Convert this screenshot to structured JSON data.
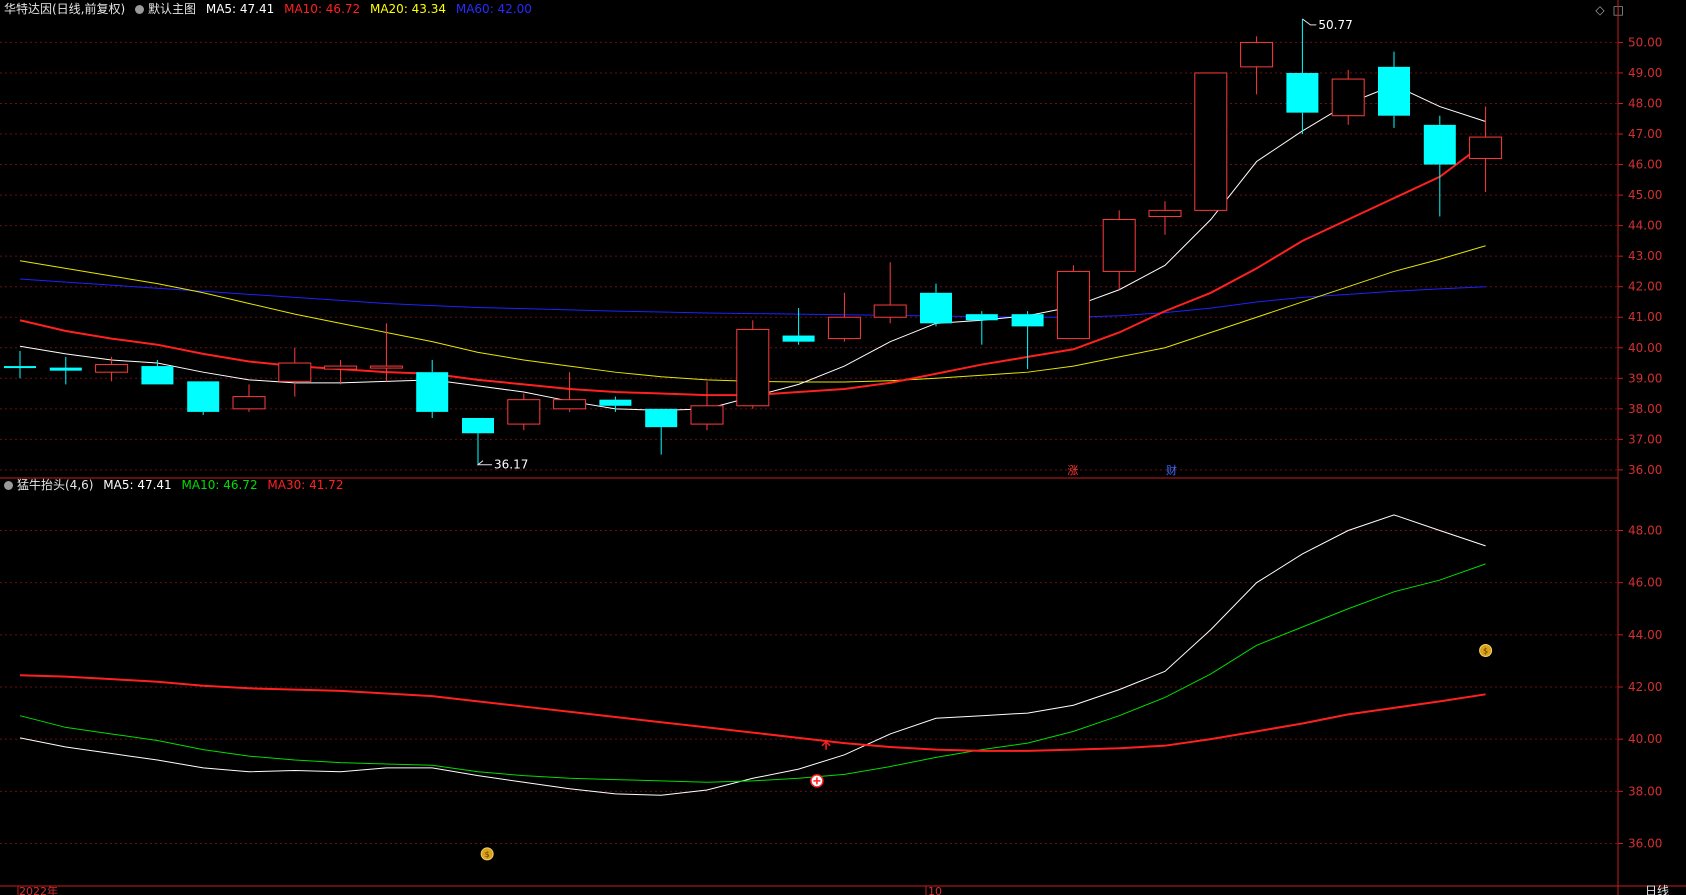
{
  "header": {
    "stock_title": "华特达因(日线,前复权)",
    "main_chart_label": "默认主图",
    "ma5": "MA5: 47.41",
    "ma10": "MA10: 46.72",
    "ma20": "MA20: 43.34",
    "ma60": "MA60: 42.00",
    "colors": {
      "ma5": "#ffffff",
      "ma10": "#ff2020",
      "ma20": "#ffff00",
      "ma60": "#2020ff",
      "up": "#ff3b3b",
      "down": "#00ffff"
    }
  },
  "indicator_header": {
    "name": "猛牛抬头(4,6)",
    "ma5": "MA5: 47.41",
    "ma10": "MA10: 46.72",
    "ma30": "MA30: 41.72",
    "colors": {
      "ma5": "#ffffff",
      "ma10": "#00dd00",
      "ma30": "#ff2020"
    }
  },
  "annotations": {
    "high_label": "50.77",
    "low_label": "36.17",
    "zhang_badge": "涨",
    "cai_badge": "财"
  },
  "bottom_axis": {
    "year_label": "2022年",
    "month_label": "10",
    "period_label": "日线"
  },
  "chart_data": [
    {
      "type": "candlestick",
      "ylim": [
        35.8,
        50.8
      ],
      "y_ticks": [
        "50.00",
        "49.00",
        "48.00",
        "47.00",
        "46.00",
        "45.00",
        "44.00",
        "43.00",
        "42.00",
        "41.00",
        "40.00",
        "39.00",
        "38.00",
        "37.00",
        "36.00"
      ],
      "grid": "horizontal dotted",
      "candles": [
        {
          "o": 39.4,
          "h": 39.9,
          "l": 39.0,
          "c": 39.35
        },
        {
          "o": 39.35,
          "h": 39.7,
          "l": 38.8,
          "c": 39.25
        },
        {
          "o": 39.2,
          "h": 39.7,
          "l": 38.9,
          "c": 39.45
        },
        {
          "o": 39.4,
          "h": 39.6,
          "l": 38.8,
          "c": 38.8
        },
        {
          "o": 38.9,
          "h": 38.9,
          "l": 37.8,
          "c": 37.9
        },
        {
          "o": 38.0,
          "h": 38.8,
          "l": 37.9,
          "c": 38.4
        },
        {
          "o": 38.9,
          "h": 40.0,
          "l": 38.4,
          "c": 39.5
        },
        {
          "o": 39.3,
          "h": 39.6,
          "l": 38.8,
          "c": 39.4
        },
        {
          "o": 39.35,
          "h": 40.8,
          "l": 38.9,
          "c": 39.4
        },
        {
          "o": 39.2,
          "h": 39.6,
          "l": 37.7,
          "c": 37.9
        },
        {
          "o": 37.7,
          "h": 37.7,
          "l": 36.17,
          "c": 37.2
        },
        {
          "o": 37.5,
          "h": 38.5,
          "l": 37.3,
          "c": 38.3
        },
        {
          "o": 38.0,
          "h": 39.2,
          "l": 37.9,
          "c": 38.3
        },
        {
          "o": 38.3,
          "h": 38.4,
          "l": 37.9,
          "c": 38.1
        },
        {
          "o": 38.0,
          "h": 38.0,
          "l": 36.5,
          "c": 37.4
        },
        {
          "o": 37.5,
          "h": 38.9,
          "l": 37.3,
          "c": 38.1
        },
        {
          "o": 38.1,
          "h": 40.9,
          "l": 38.0,
          "c": 40.6
        },
        {
          "o": 40.4,
          "h": 41.3,
          "l": 40.1,
          "c": 40.2
        },
        {
          "o": 40.3,
          "h": 41.8,
          "l": 40.2,
          "c": 41.0
        },
        {
          "o": 41.0,
          "h": 42.8,
          "l": 40.8,
          "c": 41.4
        },
        {
          "o": 41.8,
          "h": 42.1,
          "l": 40.7,
          "c": 40.8
        },
        {
          "o": 41.1,
          "h": 41.2,
          "l": 40.1,
          "c": 40.9
        },
        {
          "o": 41.1,
          "h": 41.2,
          "l": 39.3,
          "c": 40.7
        },
        {
          "o": 40.3,
          "h": 42.7,
          "l": 40.3,
          "c": 42.5
        },
        {
          "o": 42.5,
          "h": 44.5,
          "l": 41.9,
          "c": 44.2
        },
        {
          "o": 44.3,
          "h": 44.8,
          "l": 43.7,
          "c": 44.5
        },
        {
          "o": 44.5,
          "h": 49.0,
          "l": 44.5,
          "c": 49.0
        },
        {
          "o": 49.2,
          "h": 50.2,
          "l": 48.3,
          "c": 50.0
        },
        {
          "o": 49.0,
          "h": 50.77,
          "l": 47.0,
          "c": 47.7
        },
        {
          "o": 47.6,
          "h": 49.1,
          "l": 47.3,
          "c": 48.8
        },
        {
          "o": 49.2,
          "h": 49.7,
          "l": 47.2,
          "c": 47.6
        },
        {
          "o": 47.3,
          "h": 47.6,
          "l": 44.3,
          "c": 46.0
        },
        {
          "o": 46.2,
          "h": 47.9,
          "l": 45.1,
          "c": 46.9
        }
      ],
      "series": [
        {
          "name": "MA5",
          "values": [
            40.05,
            39.8,
            39.6,
            39.5,
            39.2,
            38.95,
            38.85,
            38.85,
            38.9,
            38.95,
            38.75,
            38.55,
            38.25,
            38.0,
            37.95,
            38.0,
            38.4,
            38.8,
            39.4,
            40.2,
            40.8,
            40.9,
            41.05,
            41.35,
            41.9,
            42.7,
            44.2,
            46.1,
            47.1,
            48.0,
            48.6,
            47.9,
            47.41
          ]
        },
        {
          "name": "MA10",
          "values": [
            40.9,
            40.55,
            40.3,
            40.1,
            39.8,
            39.55,
            39.4,
            39.3,
            39.2,
            39.15,
            38.95,
            38.8,
            38.65,
            38.55,
            38.5,
            38.45,
            38.45,
            38.55,
            38.65,
            38.85,
            39.15,
            39.45,
            39.7,
            39.95,
            40.5,
            41.2,
            41.8,
            42.6,
            43.5,
            44.2,
            44.9,
            45.6,
            46.72
          ]
        },
        {
          "name": "MA20",
          "values": [
            42.85,
            42.6,
            42.35,
            42.1,
            41.8,
            41.45,
            41.1,
            40.8,
            40.5,
            40.2,
            39.85,
            39.6,
            39.4,
            39.2,
            39.05,
            38.95,
            38.9,
            38.88,
            38.88,
            38.92,
            39.0,
            39.1,
            39.2,
            39.4,
            39.7,
            40.0,
            40.5,
            41.0,
            41.5,
            42.0,
            42.5,
            42.9,
            43.34
          ]
        },
        {
          "name": "MA60",
          "values": [
            42.25,
            42.15,
            42.05,
            41.95,
            41.85,
            41.75,
            41.65,
            41.55,
            41.45,
            41.38,
            41.32,
            41.28,
            41.24,
            41.2,
            41.17,
            41.14,
            41.12,
            41.1,
            41.08,
            41.06,
            41.04,
            41.02,
            41.0,
            41.0,
            41.05,
            41.15,
            41.3,
            41.5,
            41.65,
            41.75,
            41.85,
            41.93,
            42.0
          ]
        }
      ]
    },
    {
      "type": "line",
      "ylim": [
        34.6,
        49.4
      ],
      "y_ticks": [
        "48.00",
        "46.00",
        "44.00",
        "42.00",
        "40.00",
        "38.00",
        "36.00"
      ],
      "grid": "horizontal dotted",
      "series": [
        {
          "name": "MA5",
          "values": [
            40.05,
            39.7,
            39.45,
            39.2,
            38.9,
            38.75,
            38.8,
            38.75,
            38.9,
            38.9,
            38.6,
            38.35,
            38.1,
            37.9,
            37.85,
            38.05,
            38.5,
            38.85,
            39.4,
            40.2,
            40.8,
            40.9,
            41.0,
            41.3,
            41.9,
            42.6,
            44.2,
            46.0,
            47.1,
            48.0,
            48.6,
            48.0,
            47.41
          ]
        },
        {
          "name": "MA10",
          "values": [
            40.9,
            40.45,
            40.2,
            39.95,
            39.6,
            39.35,
            39.2,
            39.1,
            39.05,
            39.0,
            38.75,
            38.6,
            38.5,
            38.45,
            38.4,
            38.35,
            38.4,
            38.5,
            38.65,
            38.95,
            39.3,
            39.6,
            39.85,
            40.3,
            40.9,
            41.6,
            42.5,
            43.6,
            44.3,
            45.0,
            45.65,
            46.1,
            46.72
          ]
        },
        {
          "name": "MA30",
          "values": [
            42.45,
            42.4,
            42.3,
            42.2,
            42.05,
            41.95,
            41.9,
            41.85,
            41.75,
            41.65,
            41.45,
            41.25,
            41.05,
            40.85,
            40.65,
            40.45,
            40.25,
            40.05,
            39.85,
            39.7,
            39.6,
            39.55,
            39.55,
            39.6,
            39.65,
            39.75,
            40.0,
            40.3,
            40.6,
            40.95,
            41.2,
            41.45,
            41.72
          ]
        }
      ]
    }
  ]
}
